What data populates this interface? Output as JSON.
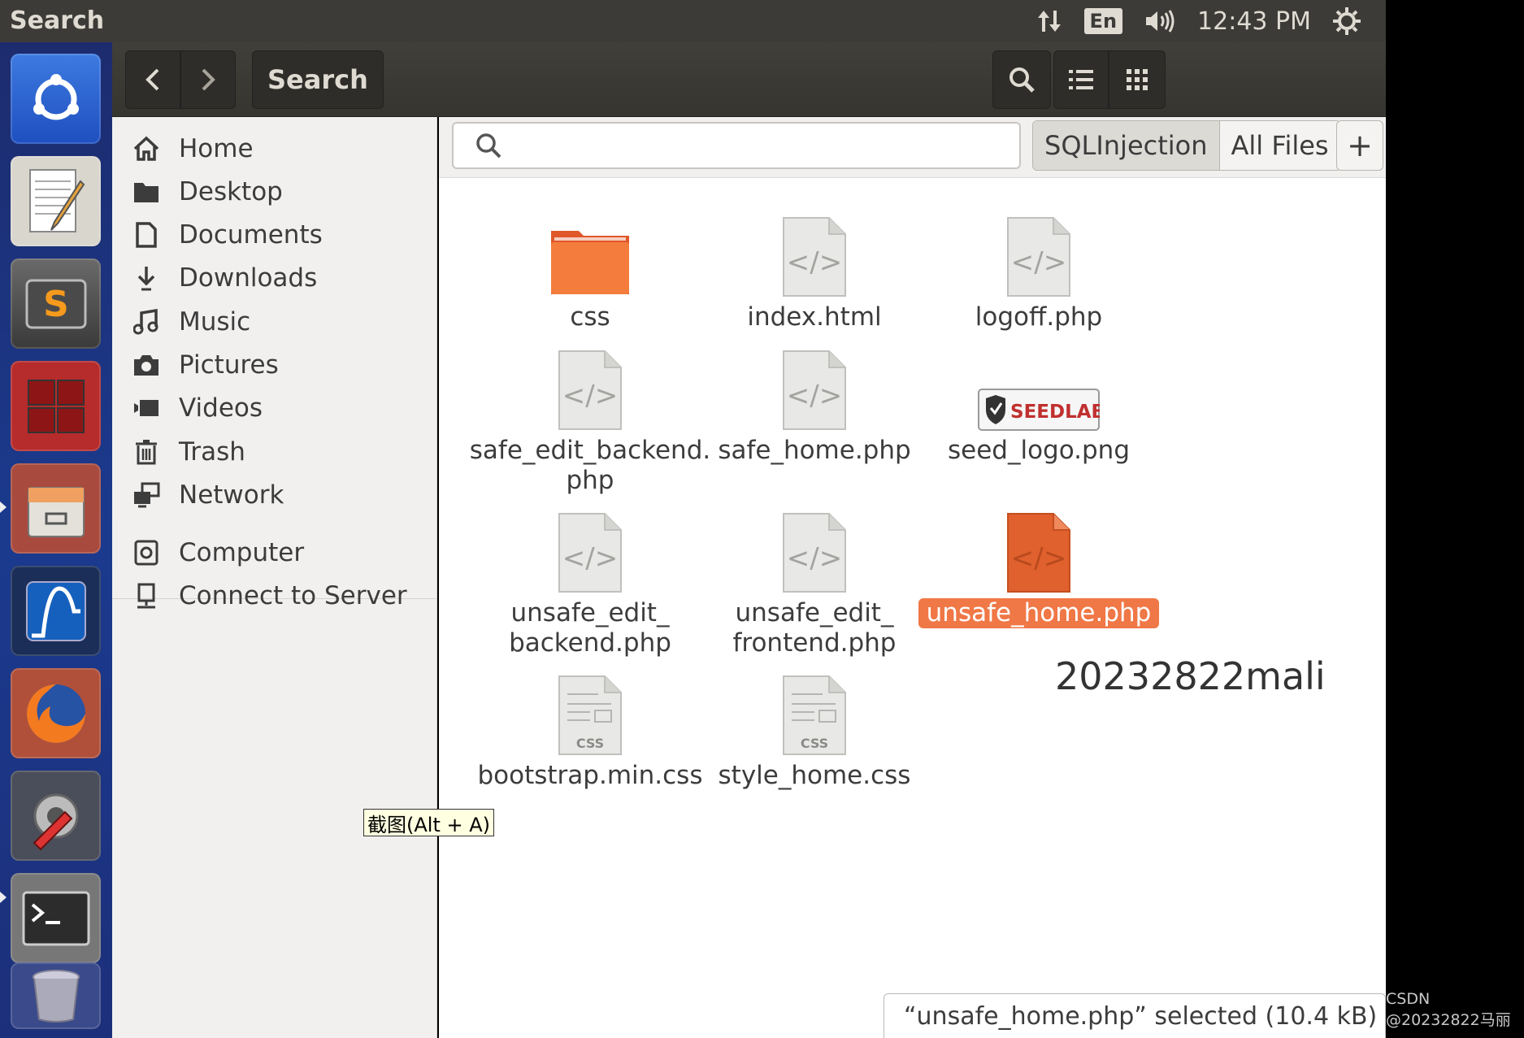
{
  "top_panel": {
    "title": "Search",
    "language": "En",
    "clock": "12:43 PM"
  },
  "launcher": {
    "items": [
      "ubuntu-dash-icon",
      "text-editor-icon",
      "sublime-text-icon",
      "workspace-switcher-icon",
      "files-icon",
      "wireshark-icon",
      "firefox-icon",
      "system-settings-icon",
      "terminal-icon",
      "trash-can-icon"
    ]
  },
  "headerbar": {
    "title": "Search"
  },
  "sidebar": {
    "places": [
      {
        "label": "Home",
        "icon": "home-icon"
      },
      {
        "label": "Desktop",
        "icon": "folder-icon"
      },
      {
        "label": "Documents",
        "icon": "document-icon"
      },
      {
        "label": "Downloads",
        "icon": "download-icon"
      },
      {
        "label": "Music",
        "icon": "music-icon"
      },
      {
        "label": "Pictures",
        "icon": "camera-icon"
      },
      {
        "label": "Videos",
        "icon": "video-icon"
      },
      {
        "label": "Trash",
        "icon": "trash-icon"
      },
      {
        "label": "Network",
        "icon": "network-icon"
      }
    ],
    "devices": [
      {
        "label": "Computer",
        "icon": "computer-icon"
      },
      {
        "label": "Connect to Server",
        "icon": "server-icon"
      }
    ]
  },
  "search": {
    "placeholder": "",
    "scopes": [
      "SQLInjection",
      "All Files"
    ],
    "add_label": "+"
  },
  "files": [
    {
      "name": "css",
      "type": "folder"
    },
    {
      "name": "index.html",
      "type": "code"
    },
    {
      "name": "logoff.php",
      "type": "code"
    },
    {
      "name": "safe_edit_backend.\nphp",
      "type": "code"
    },
    {
      "name": "safe_home.php",
      "type": "code"
    },
    {
      "name": "seed_logo.png",
      "type": "image"
    },
    {
      "name": "unsafe_edit_\nbackend.php",
      "type": "code"
    },
    {
      "name": "unsafe_edit_\nfrontend.php",
      "type": "code"
    },
    {
      "name": "unsafe_home.php",
      "type": "code",
      "selected": true
    },
    {
      "name": "bootstrap.min.css",
      "type": "css"
    },
    {
      "name": "style_home.css",
      "type": "css"
    }
  ],
  "overlay_text": "20232822mali",
  "tooltip": "截图(Alt + A)",
  "status": "“unsafe_home.php” selected  (10.4 kB)",
  "seed_logo_text": "SEEDLABS",
  "css_badge": "CSS",
  "watermark": "CSDN @20232822马丽",
  "colors": {
    "selection": "#f07746",
    "top_panel": "#3c3b37",
    "launcher": "#1b3a8e",
    "folder": "#f07746"
  }
}
